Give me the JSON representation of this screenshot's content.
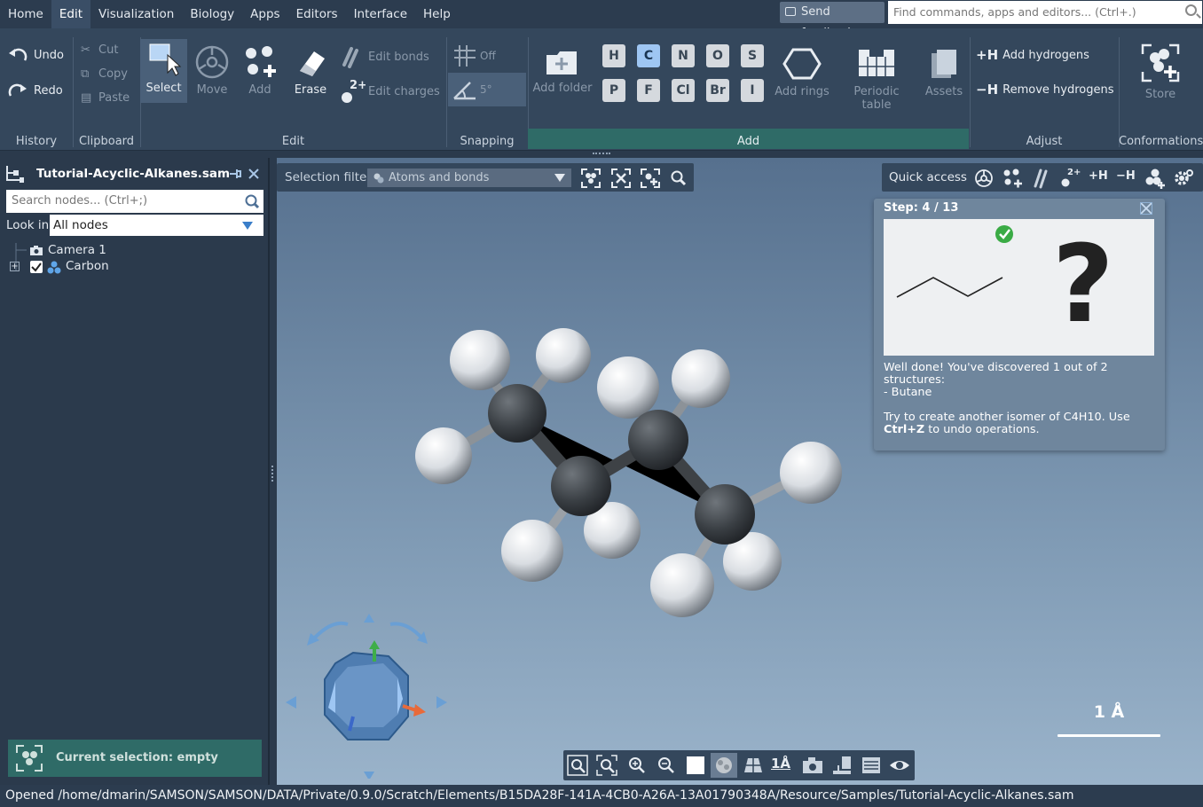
{
  "menubar": {
    "items": [
      "Home",
      "Edit",
      "Visualization",
      "Biology",
      "Apps",
      "Editors",
      "Interface",
      "Help"
    ],
    "active": "Edit",
    "feedback": "Send feedback",
    "search_placeholder": "Find commands, apps and editors... (Ctrl+.)"
  },
  "ribbon": {
    "history": {
      "undo": "Undo",
      "redo": "Redo",
      "group": "History"
    },
    "clipboard": {
      "cut": "Cut",
      "copy": "Copy",
      "paste": "Paste",
      "group": "Clipboard"
    },
    "edit": {
      "select": "Select",
      "move": "Move",
      "add": "Add",
      "erase": "Erase",
      "edit_bonds": "Edit bonds",
      "edit_charges": "Edit charges",
      "group": "Edit"
    },
    "snapping": {
      "off": "Off",
      "angle": "5°",
      "group": "Snapping"
    },
    "add": {
      "add_folder": "Add folder",
      "elements_row1": [
        "H",
        "C",
        "N",
        "O",
        "S"
      ],
      "elements_row2": [
        "P",
        "F",
        "Cl",
        "Br",
        "I"
      ],
      "selected_element": "C",
      "add_rings": "Add rings",
      "periodic_table": "Periodic table",
      "assets": "Assets",
      "group": "Add"
    },
    "adjust": {
      "add_hydrogens": "Add hydrogens",
      "remove_hydrogens": "Remove hydrogens",
      "group": "Adjust"
    },
    "conformations": {
      "store": "Store",
      "group": "Conformations"
    }
  },
  "document_panel": {
    "title": "Tutorial-Acyclic-Alkanes.sam",
    "search_placeholder": "Search nodes... (Ctrl+;)",
    "look_in_label": "Look in",
    "look_in_value": "All nodes",
    "nodes": [
      {
        "label": "Camera 1"
      },
      {
        "label": "Carbon"
      }
    ],
    "current_selection": "Current selection: empty"
  },
  "viewport": {
    "selection_filter_label": "Selection filter",
    "selection_filter_value": "Atoms and bonds",
    "quick_access_label": "Quick access",
    "scale_label": "1 Å"
  },
  "tutorial": {
    "step": "Step: 4 / 13",
    "line1": "Well done! You've discovered 1 out of 2 structures:",
    "line2": "- Butane",
    "line3a": "Try to create another isomer of C4H10. Use ",
    "line3b": "Ctrl+Z",
    "line3c": " to undo operations.",
    "question": "?"
  },
  "status": "Opened /home/dmarin/SAMSON/SAMSON/DATA/Private/0.9.0/Scratch/Elements/B15DA28F-141A-4CB0-A26A-13A01790348A/Resource/Samples/Tutorial-Acyclic-Alkanes.sam",
  "colors": {
    "accent": "#2f6b67",
    "panel": "#34475c",
    "selected": "#9ec6f3"
  },
  "molecule": {
    "carbons": 4,
    "hydrogens": 10
  }
}
